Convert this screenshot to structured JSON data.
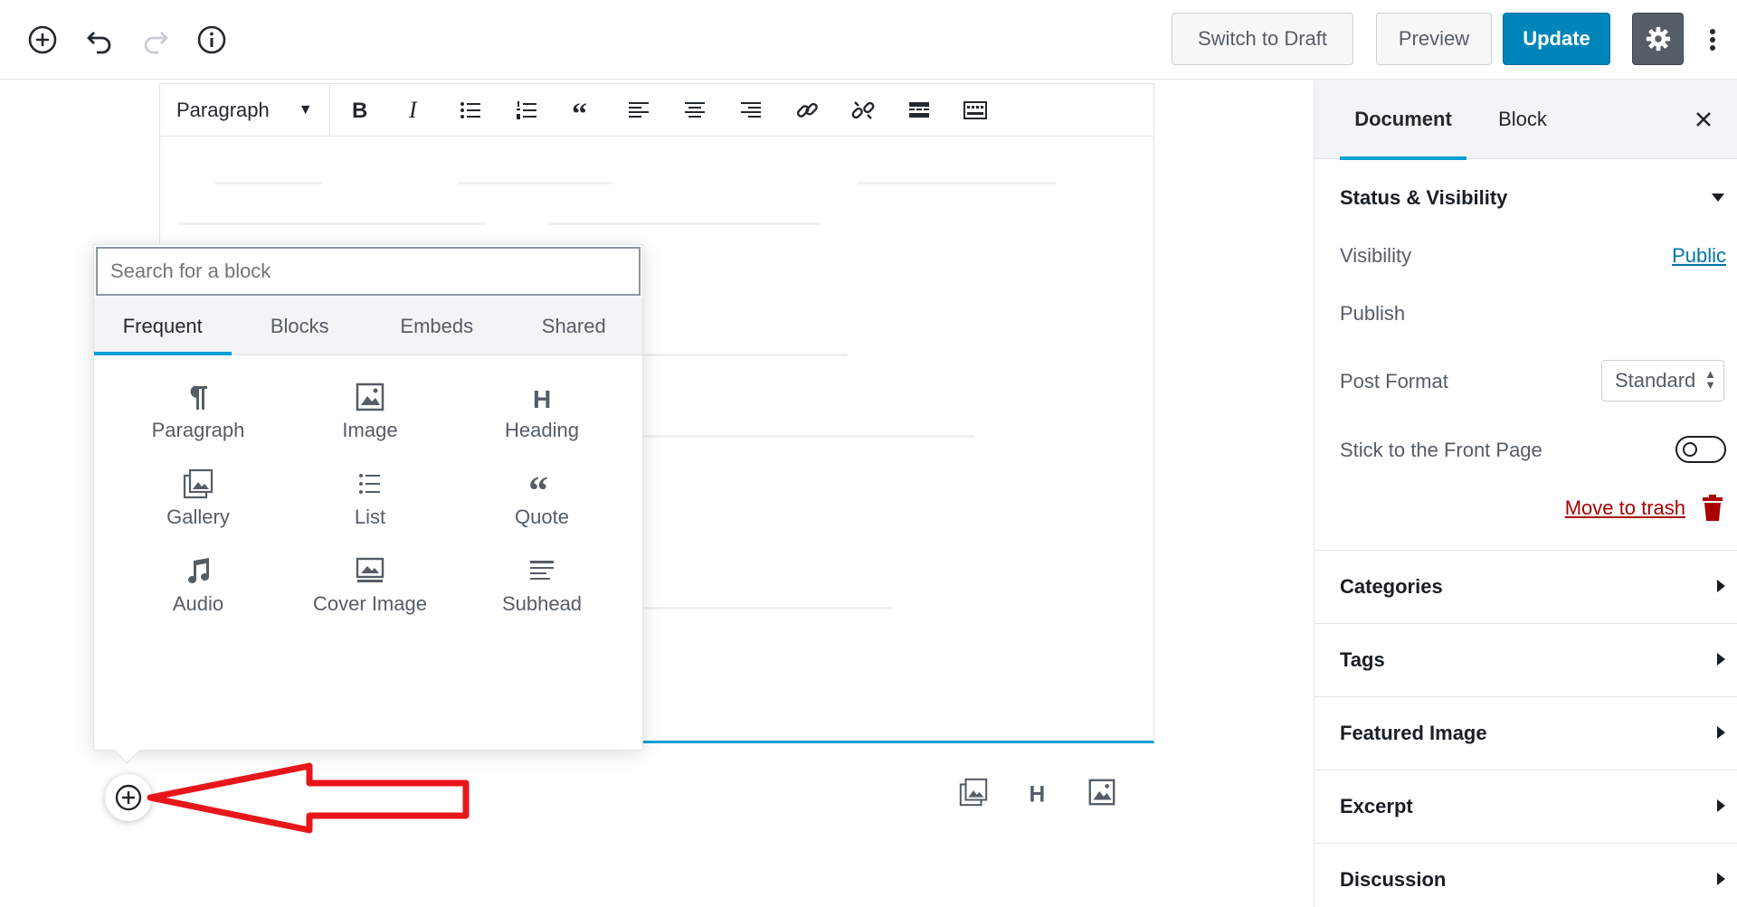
{
  "topbar": {
    "add_block_icon": "plus-circle-icon",
    "undo_icon": "undo-icon",
    "redo_icon": "redo-icon",
    "info_icon": "info-icon",
    "switch_to_draft": "Switch to Draft",
    "preview": "Preview",
    "update": "Update",
    "settings_icon": "gear-icon",
    "more_icon": "more-vertical-icon"
  },
  "block_toolbar": {
    "block_type": "Paragraph",
    "buttons": [
      "bold-icon",
      "italic-icon",
      "bullet-list-icon",
      "numbered-list-icon",
      "quote-icon",
      "align-left-icon",
      "align-center-icon",
      "align-right-icon",
      "link-icon",
      "unlink-icon",
      "read-more-icon",
      "keyboard-icon"
    ]
  },
  "inserter": {
    "search_placeholder": "Search for a block",
    "tabs": [
      "Frequent",
      "Blocks",
      "Embeds",
      "Shared"
    ],
    "active_tab": "Frequent",
    "blocks": [
      {
        "label": "Paragraph",
        "icon": "paragraph-icon"
      },
      {
        "label": "Image",
        "icon": "image-icon"
      },
      {
        "label": "Heading",
        "icon": "heading-icon"
      },
      {
        "label": "Gallery",
        "icon": "gallery-icon"
      },
      {
        "label": "List",
        "icon": "list-icon"
      },
      {
        "label": "Quote",
        "icon": "quote-icon"
      },
      {
        "label": "Audio",
        "icon": "audio-icon"
      },
      {
        "label": "Cover Image",
        "icon": "cover-image-icon"
      },
      {
        "label": "Subhead",
        "icon": "subhead-icon"
      }
    ]
  },
  "quick_insert": [
    "gallery-icon",
    "heading-icon",
    "image-icon"
  ],
  "sidebar": {
    "tab_document": "Document",
    "tab_block": "Block",
    "status_panel": {
      "title": "Status & Visibility",
      "visibility_label": "Visibility",
      "visibility_value": "Public",
      "publish_label": "Publish",
      "post_format_label": "Post Format",
      "post_format_value": "Standard",
      "sticky_label": "Stick to the Front Page",
      "sticky_on": false,
      "trash_label": "Move to trash"
    },
    "panels": [
      "Categories",
      "Tags",
      "Featured Image",
      "Excerpt",
      "Discussion"
    ]
  },
  "colors": {
    "accent": "#00a0d2",
    "primary_button": "#0085ba",
    "trash": "#aa0000",
    "annotation_arrow": "#e8161b"
  }
}
